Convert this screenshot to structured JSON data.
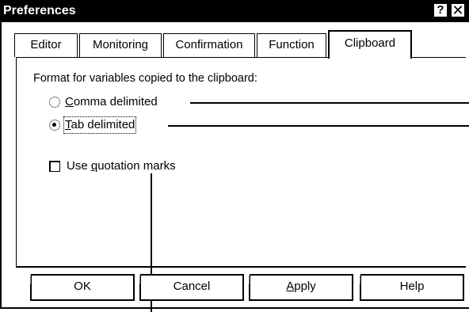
{
  "window": {
    "title": "Preferences",
    "help_button": "?",
    "close_button": "✕"
  },
  "tabs": [
    {
      "label": "Editor",
      "active": false
    },
    {
      "label": "Monitoring",
      "active": false
    },
    {
      "label": "Confirmation",
      "active": false
    },
    {
      "label": "Function",
      "active": false
    },
    {
      "label": "Clipboard",
      "active": true
    }
  ],
  "clipboard": {
    "format_label": "Format for variables copied to the clipboard:",
    "options": [
      {
        "mnemonic": "C",
        "rest": "omma delimited",
        "checked": false
      },
      {
        "mnemonic": "T",
        "rest": "ab delimited",
        "checked": true
      }
    ],
    "quotation": {
      "prefix": "Use ",
      "mnemonic": "q",
      "rest": "uotation marks",
      "checked": false
    }
  },
  "buttons": {
    "ok": "OK",
    "cancel": "Cancel",
    "apply_mnemonic": "A",
    "apply_rest": "pply",
    "help": "Help"
  },
  "colors": {
    "titlebar": "#000000",
    "background": "#ffffff"
  }
}
